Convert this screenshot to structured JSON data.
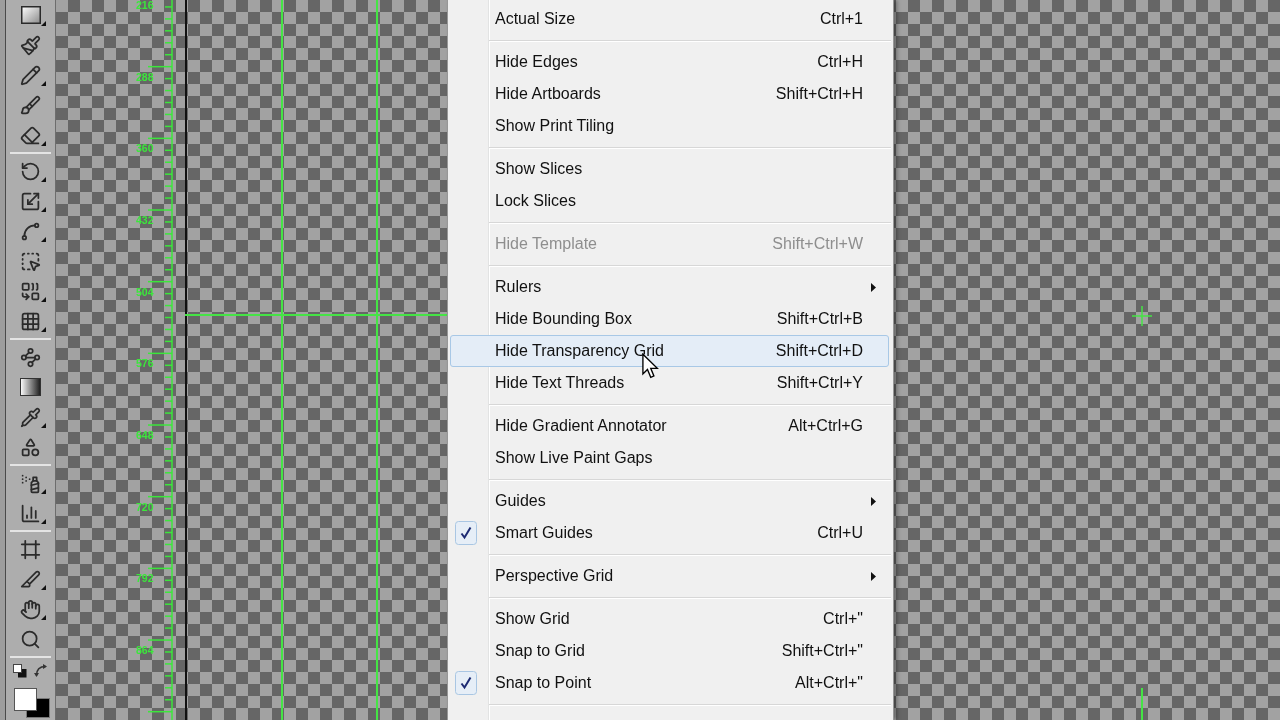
{
  "toolbar": {
    "groups": [
      {
        "tools": [
          {
            "kind": "rectangle",
            "flyout": true
          },
          {
            "kind": "paintbrush",
            "flyout": false
          },
          {
            "kind": "pencil",
            "flyout": true
          },
          {
            "kind": "blob_brush",
            "flyout": false
          },
          {
            "kind": "eraser",
            "flyout": true
          }
        ]
      },
      {
        "tools": [
          {
            "kind": "rotate",
            "flyout": true
          },
          {
            "kind": "scale",
            "flyout": true
          },
          {
            "kind": "width",
            "flyout": true
          },
          {
            "kind": "free_transform",
            "flyout": false
          },
          {
            "kind": "shape_builder",
            "flyout": true
          },
          {
            "kind": "perspective_grid",
            "flyout": true
          }
        ]
      },
      {
        "tools": [
          {
            "kind": "mesh",
            "flyout": false
          },
          {
            "kind": "gradient",
            "flyout": false
          },
          {
            "kind": "eyedropper",
            "flyout": true
          },
          {
            "kind": "blend",
            "flyout": false
          }
        ]
      },
      {
        "tools": [
          {
            "kind": "symbol_sprayer",
            "flyout": true
          },
          {
            "kind": "column_graph",
            "flyout": true
          }
        ]
      },
      {
        "tools": [
          {
            "kind": "artboard",
            "flyout": false
          },
          {
            "kind": "slice",
            "flyout": true
          },
          {
            "kind": "hand",
            "flyout": true
          },
          {
            "kind": "zoom",
            "flyout": false
          }
        ]
      }
    ],
    "colors": {
      "fill": {
        "color": "#ffffff"
      },
      "stroke": {
        "color": "#000000"
      }
    }
  },
  "ruler": {
    "labels": [
      "216",
      "288",
      "360",
      "432",
      "504",
      "576",
      "648",
      "720",
      "792",
      "864"
    ]
  },
  "menu": {
    "sections": [
      {
        "items": [
          {
            "label": "Actual Size",
            "shortcut": "Ctrl+1",
            "checked": false,
            "disabled": false,
            "selected": false,
            "has_submenu": false
          }
        ]
      },
      {
        "items": [
          {
            "label": "Hide Edges",
            "shortcut": "Ctrl+H",
            "checked": false,
            "disabled": false,
            "selected": false,
            "has_submenu": false
          },
          {
            "label": "Hide Artboards",
            "shortcut": "Shift+Ctrl+H",
            "checked": false,
            "disabled": false,
            "selected": false,
            "has_submenu": false
          },
          {
            "label": "Show Print Tiling",
            "checked": false,
            "disabled": false,
            "selected": false,
            "has_submenu": false
          }
        ]
      },
      {
        "items": [
          {
            "label": "Show Slices",
            "checked": false,
            "disabled": false,
            "selected": false,
            "has_submenu": false
          },
          {
            "label": "Lock Slices",
            "checked": false,
            "disabled": false,
            "selected": false,
            "has_submenu": false
          }
        ]
      },
      {
        "items": [
          {
            "label": "Hide Template",
            "shortcut": "Shift+Ctrl+W",
            "checked": false,
            "disabled": true,
            "selected": false,
            "has_submenu": false
          }
        ]
      },
      {
        "items": [
          {
            "label": "Rulers",
            "checked": false,
            "disabled": false,
            "selected": false,
            "has_submenu": true
          },
          {
            "label": "Hide Bounding Box",
            "shortcut": "Shift+Ctrl+B",
            "checked": false,
            "disabled": false,
            "selected": false,
            "has_submenu": false
          },
          {
            "label": "Hide Transparency Grid",
            "shortcut": "Shift+Ctrl+D",
            "checked": false,
            "disabled": false,
            "selected": true,
            "has_submenu": false
          },
          {
            "label": "Hide Text Threads",
            "shortcut": "Shift+Ctrl+Y",
            "checked": false,
            "disabled": false,
            "selected": false,
            "has_submenu": false
          }
        ]
      },
      {
        "items": [
          {
            "label": "Hide Gradient Annotator",
            "shortcut": "Alt+Ctrl+G",
            "checked": false,
            "disabled": false,
            "selected": false,
            "has_submenu": false
          },
          {
            "label": "Show Live Paint Gaps",
            "checked": false,
            "disabled": false,
            "selected": false,
            "has_submenu": false
          }
        ]
      },
      {
        "items": [
          {
            "label": "Guides",
            "checked": false,
            "disabled": false,
            "selected": false,
            "has_submenu": true
          },
          {
            "label": "Smart Guides",
            "shortcut": "Ctrl+U",
            "checked": true,
            "disabled": false,
            "selected": false,
            "has_submenu": false
          }
        ]
      },
      {
        "items": [
          {
            "label": "Perspective Grid",
            "checked": false,
            "disabled": false,
            "selected": false,
            "has_submenu": true
          }
        ]
      },
      {
        "items": [
          {
            "label": "Show Grid",
            "shortcut": "Ctrl+\"",
            "checked": false,
            "disabled": false,
            "selected": false,
            "has_submenu": false
          },
          {
            "label": "Snap to Grid",
            "shortcut": "Shift+Ctrl+\"",
            "checked": false,
            "disabled": false,
            "selected": false,
            "has_submenu": false
          },
          {
            "label": "Snap to Point",
            "shortcut": "Alt+Ctrl+\"",
            "checked": true,
            "disabled": false,
            "selected": false,
            "has_submenu": false
          }
        ]
      }
    ]
  }
}
